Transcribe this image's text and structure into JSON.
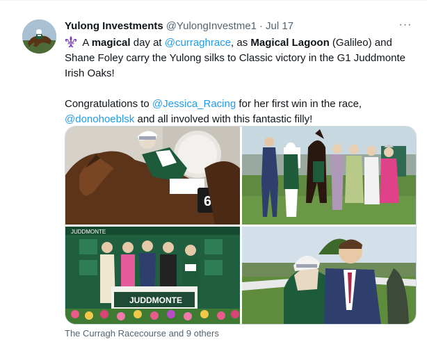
{
  "tweet": {
    "author_name": "Yulong Investments",
    "author_handle": "@YulongInvestme1",
    "separator": "·",
    "date": "Jul 17",
    "more_label": "···",
    "text": {
      "p1_a": " A ",
      "p1_b": "magical",
      "p1_c": " day at ",
      "p1_mention": "@curraghrace",
      "p1_d": ", as ",
      "p1_e": "Magical Lagoon",
      "p1_f": " (Galileo) and Shane Foley carry the Yulong silks to Classic victory in the G1 Juddmonte Irish Oaks!",
      "p2_a": "Congratulations to ",
      "p2_mention1": "@Jessica_Racing",
      "p2_b": " for her first win in the race, ",
      "p2_mention2": "@donohoeblsk",
      "p2_c": " and all involved with this fantastic filly!"
    },
    "media_caption": "The Curragh Racecourse and 9 others",
    "photo_text": {
      "saddlecloth_number": "6",
      "sponsor_board": "JUDDMONTE",
      "banner": "JUDDMONTE"
    },
    "icons": {
      "emoji": "fleur-de-lis-icon",
      "more": "more-options-icon"
    },
    "colors": {
      "link": "#1d9bf0",
      "secondary_text": "#536471",
      "primary_text": "#0f1419",
      "emoji_purple": "#7b3fb8",
      "silks_green": "#1e5b3a"
    }
  }
}
